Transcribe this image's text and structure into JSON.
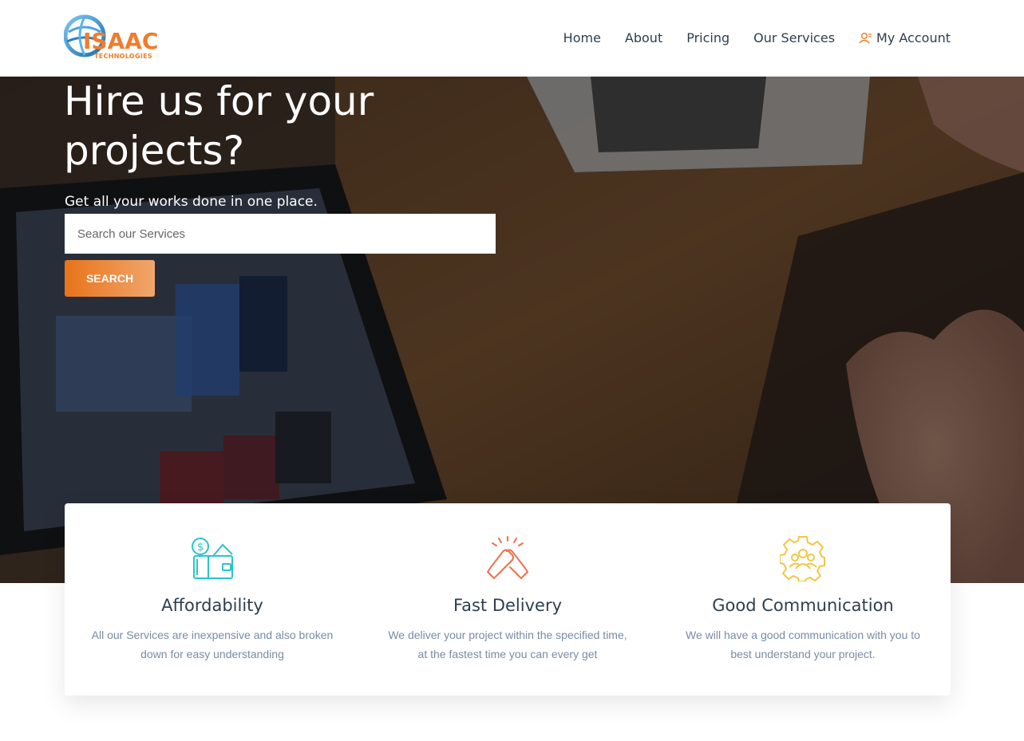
{
  "brand": {
    "logo_text": "ISAAC",
    "logo_subtext": "TECHNOLOGIES",
    "accent_color": "#ef7d2c"
  },
  "nav": {
    "items": [
      {
        "label": "Home"
      },
      {
        "label": "About"
      },
      {
        "label": "Pricing"
      },
      {
        "label": "Our Services"
      }
    ],
    "account": {
      "label": "My Account",
      "icon": "user-icon"
    }
  },
  "hero": {
    "title": "Hire us for your projects?",
    "subtitle": "Get all your works done in one place.",
    "search": {
      "placeholder": "Search our Services",
      "value": "",
      "button_label": "SEARCH"
    }
  },
  "features": [
    {
      "icon": "wallet-coin-icon",
      "icon_color": "#2bc4c9",
      "title": "Affordability",
      "description": "All our Services are inexpensive and also broken down for easy understanding"
    },
    {
      "icon": "handshake-icon",
      "icon_color": "#f0704a",
      "title": "Fast Delivery",
      "description": "We deliver your project within the specified time, at the fastest time you can every get"
    },
    {
      "icon": "team-gear-icon",
      "icon_color": "#f2c744",
      "title": "Good Communication",
      "description": "We will have a good communication with you to best understand your project."
    }
  ]
}
